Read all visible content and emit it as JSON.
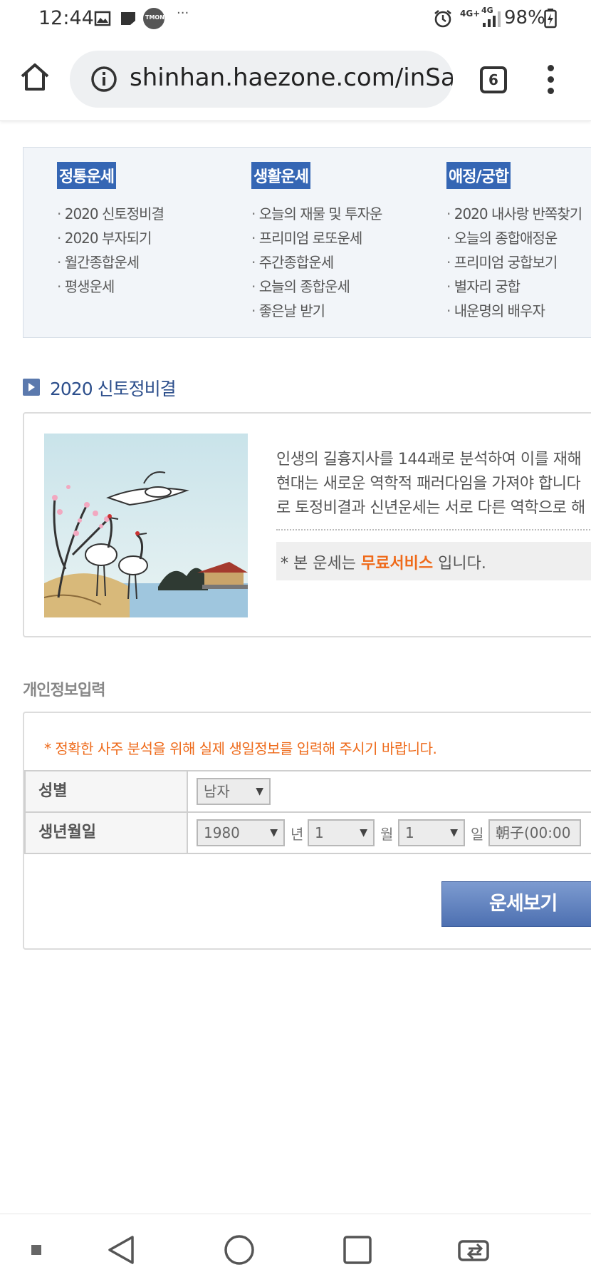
{
  "status_bar": {
    "time": "12:44",
    "overflow": "···",
    "notification_icons": [
      "image-icon",
      "note-icon",
      "tmon-icon"
    ],
    "tmon_label": "TMON",
    "system_icons": [
      "alarm-icon",
      "lte-icon",
      "signal-icon"
    ],
    "lte_label": "4G+",
    "net_label": "4G",
    "battery": "98%"
  },
  "browser": {
    "url": "shinhan.haezone.com/inSa",
    "tab_count": "6"
  },
  "menu": {
    "columns": [
      {
        "title": "정통운세",
        "items": [
          "2020 신토정비결",
          "2020 부자되기",
          "월간종합운세",
          "평생운세"
        ]
      },
      {
        "title": "생활운세",
        "items": [
          "오늘의 재물 및 투자운",
          "프리미엄 로또운세",
          "주간종합운세",
          "오늘의 종합운세",
          "좋은날 받기"
        ]
      },
      {
        "title": "애정/궁합",
        "items": [
          "2020 내사랑 반쪽찾기",
          "오늘의 종합애정운",
          "프리미엄 궁합보기",
          "별자리 궁합",
          "내운명의 배우자"
        ]
      }
    ]
  },
  "section": {
    "title": "2020 신토정비결"
  },
  "intro": {
    "lines": [
      "인생의 길흉지사를 144괘로 분석하여 이를 재해",
      "현대는 새로운 역학적 패러다임을 가져야 합니다",
      "로 토정비결과 신년운세는 서로 다른 역학으로 해"
    ],
    "free_prefix": "* 본 운세는 ",
    "free_highlight": "무료서비스",
    "free_suffix": " 입니다."
  },
  "form": {
    "section_label": "개인정보입력",
    "notice": "* 정확한 사주 분석을 위해 실제 생일정보를 입력해 주시기 바랍니다.",
    "gender_label": "성별",
    "gender_value": "남자",
    "birth_label": "생년월일",
    "year_value": "1980",
    "year_unit": "년",
    "month_value": "1",
    "month_unit": "월",
    "day_value": "1",
    "day_unit": "일",
    "time_value": "朝子(00:00",
    "submit_label": "운세보기"
  },
  "navbar": {
    "icons": [
      "dot-icon",
      "back-icon",
      "home-circle-icon",
      "recents-icon",
      "switch-app-icon"
    ]
  }
}
